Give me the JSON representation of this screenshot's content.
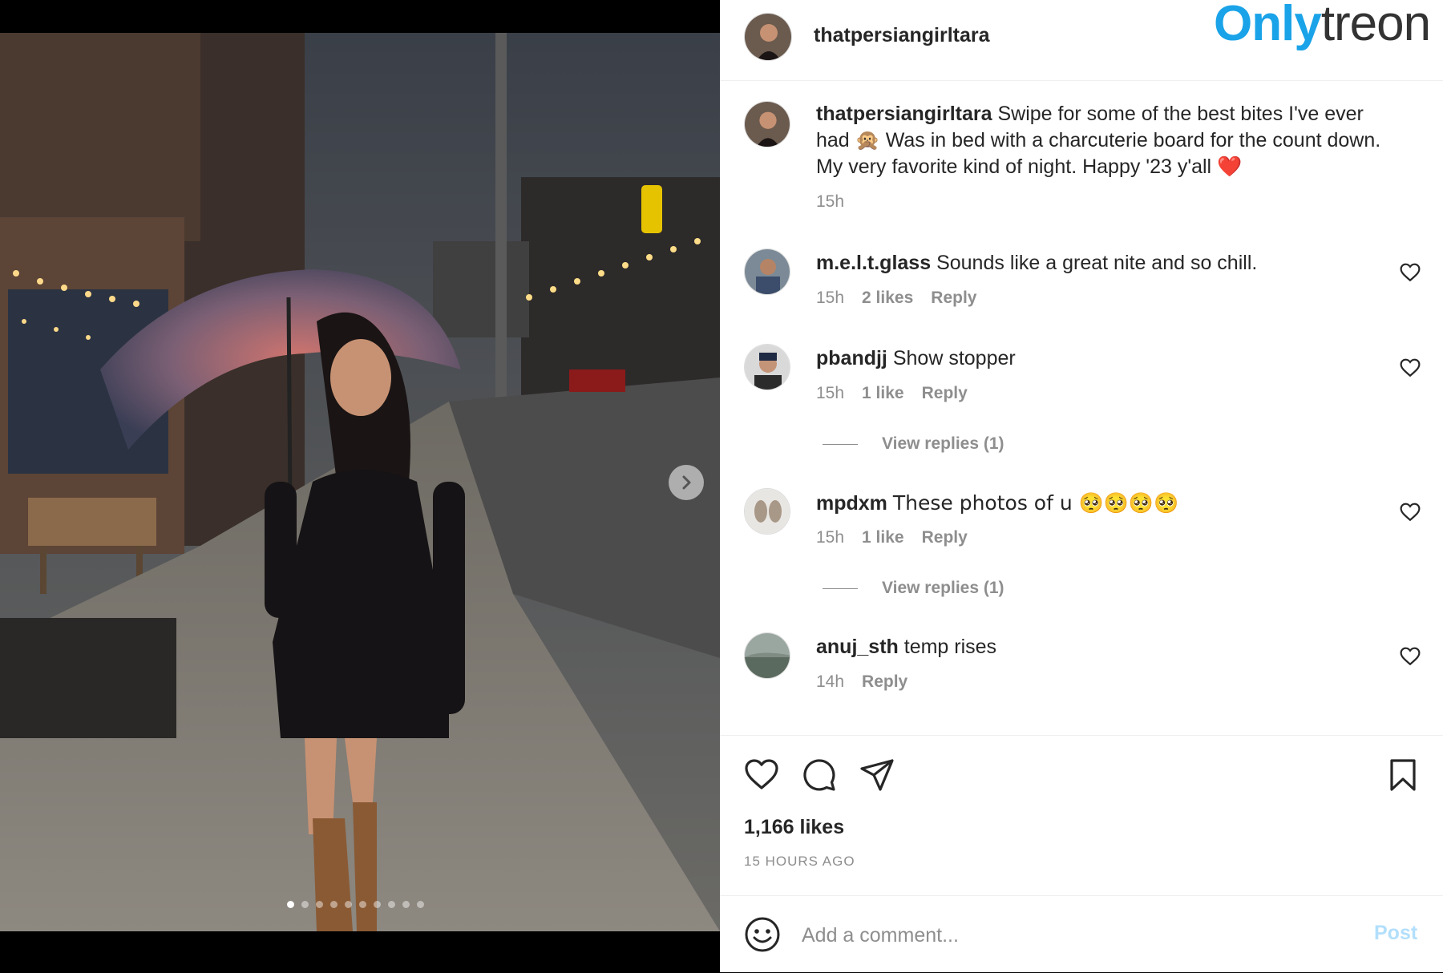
{
  "post": {
    "username": "thatpersiangirltara",
    "caption": {
      "username": "thatpersiangirltara",
      "text": "Swipe for some of the best bites I've ever had 🙊 Was in bed with a charcuterie board for the count down. My very favorite kind of night. Happy '23 y'all ❤️",
      "time": "15h"
    },
    "likes": "1,166 likes",
    "time_ago": "15 HOURS AGO",
    "carousel": {
      "total_slides": 10,
      "active_slide": 1
    }
  },
  "brand": {
    "part1": "Only",
    "part2": "treon",
    "color1": "#1aa3e8",
    "color2": "#333333"
  },
  "comments": [
    {
      "username": "m.e.l.t.glass",
      "text": "Sounds like a great nite and so chill.",
      "time": "15h",
      "likes": "2 likes",
      "reply": "Reply"
    },
    {
      "username": "pbandjj",
      "text": "Show stopper",
      "time": "15h",
      "likes": "1 like",
      "reply": "Reply",
      "view_replies": "View replies (1)"
    },
    {
      "username": "mpdxm",
      "text": "These photos of u 🥺🥺🥺🥺",
      "time": "15h",
      "likes": "1 like",
      "reply": "Reply",
      "view_replies": "View replies (1)"
    },
    {
      "username": "anuj_sth",
      "text": "temp rises",
      "time": "14h",
      "reply": "Reply"
    }
  ],
  "add_comment": {
    "placeholder": "Add a comment...",
    "post_label": "Post"
  },
  "icons": {
    "like": "heart-icon",
    "comment": "comment-icon",
    "share": "send-icon",
    "save": "bookmark-icon",
    "emoji": "smiley-icon",
    "next": "chevron-right-icon"
  },
  "colors": {
    "link_disabled": "#b2dffc",
    "muted": "#8e8e8e",
    "text": "#262626"
  }
}
